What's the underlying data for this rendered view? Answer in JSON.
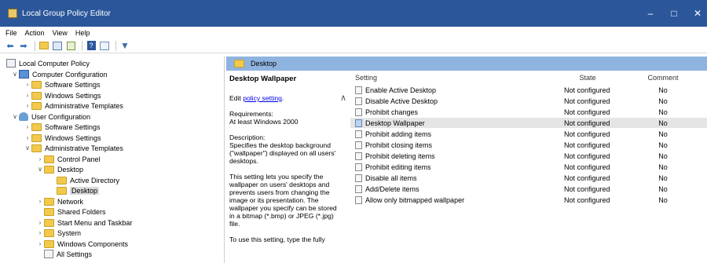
{
  "window": {
    "title": "Local Group Policy Editor",
    "controls": {
      "minimize": "–",
      "maximize": "□",
      "close": "✕"
    }
  },
  "menu": [
    "File",
    "Action",
    "View",
    "Help"
  ],
  "toolbar": [
    "back-icon",
    "forward-icon",
    "up-folder-icon",
    "show-hide-tree-icon",
    "export-list-icon",
    "help-icon",
    "properties-icon",
    "filter-icon"
  ],
  "tree": {
    "root": "Local Computer Policy",
    "computer_config": "Computer Configuration",
    "cc_software": "Software Settings",
    "cc_windows": "Windows Settings",
    "cc_admin": "Administrative Templates",
    "user_config": "User Configuration",
    "uc_software": "Software Settings",
    "uc_windows": "Windows Settings",
    "uc_admin": "Administrative Templates",
    "control_panel": "Control Panel",
    "desktop": "Desktop",
    "active_directory": "Active Directory",
    "desktop_selected": "Desktop",
    "network": "Network",
    "shared_folders": "Shared Folders",
    "start_menu": "Start Menu and Taskbar",
    "system": "System",
    "windows_components": "Windows Components",
    "all_settings": "All Settings"
  },
  "pane": {
    "header": "Desktop",
    "desc_title": "Desktop Wallpaper",
    "edit_prefix": "Edit ",
    "edit_link": "policy setting",
    "edit_suffix": ".",
    "req_label": "Requirements:",
    "req_value": "At least Windows 2000",
    "desc_label": "Description:",
    "desc_text": "Specifies the desktop background (\"wallpaper\") displayed on all users' desktops.",
    "desc_text2": "This setting lets you specify the wallpaper on users' desktops and prevents users from changing the image or its presentation. The wallpaper you specify can be stored in a bitmap (*.bmp) or JPEG (*.jpg) file.",
    "desc_text3": "To use this setting, type the fully"
  },
  "columns": {
    "setting": "Setting",
    "state": "State",
    "comment": "Comment"
  },
  "rows": [
    {
      "setting": "Enable Active Desktop",
      "state": "Not configured",
      "comment": "No"
    },
    {
      "setting": "Disable Active Desktop",
      "state": "Not configured",
      "comment": "No"
    },
    {
      "setting": "Prohibit changes",
      "state": "Not configured",
      "comment": "No"
    },
    {
      "setting": "Desktop Wallpaper",
      "state": "Not configured",
      "comment": "No"
    },
    {
      "setting": "Prohibit adding items",
      "state": "Not configured",
      "comment": "No"
    },
    {
      "setting": "Prohibit closing items",
      "state": "Not configured",
      "comment": "No"
    },
    {
      "setting": "Prohibit deleting items",
      "state": "Not configured",
      "comment": "No"
    },
    {
      "setting": "Prohibit editing items",
      "state": "Not configured",
      "comment": "No"
    },
    {
      "setting": "Disable all items",
      "state": "Not configured",
      "comment": "No"
    },
    {
      "setting": "Add/Delete items",
      "state": "Not configured",
      "comment": "No"
    },
    {
      "setting": "Allow only bitmapped wallpaper",
      "state": "Not configured",
      "comment": "No"
    }
  ],
  "selected_row": 3,
  "colors": {
    "titlebar": "#2b579a",
    "pane_header": "#8fb3df",
    "selection": "#e5e5e5",
    "link": "#0000ee"
  }
}
